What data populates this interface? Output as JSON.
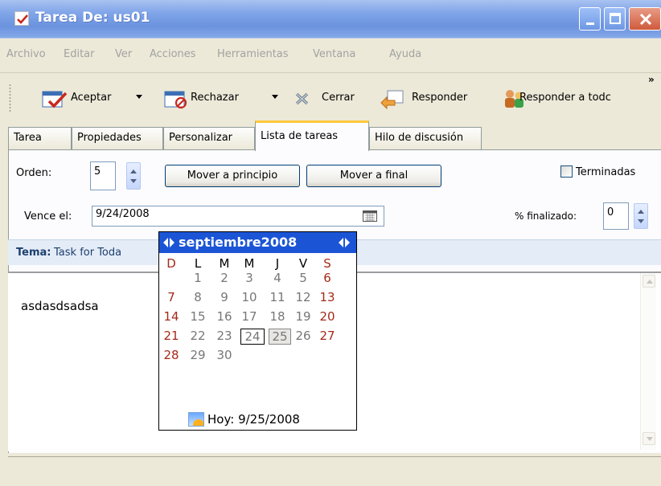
{
  "window": {
    "title": "Tarea De: us01",
    "accent": "#7fa4e8"
  },
  "menu": [
    "Archivo",
    "Editar",
    "Ver",
    "Acciones",
    "Herramientas",
    "Ventana",
    "Ayuda"
  ],
  "toolbar": {
    "accept": "Aceptar",
    "reject": "Rechazar",
    "close": "Cerrar",
    "reply": "Responder",
    "reply_all": "Responder a todc",
    "more": "»"
  },
  "tabs": [
    "Tarea",
    "Propiedades",
    "Personalizar",
    "Lista de tareas",
    "Hilo de discusión"
  ],
  "active_tab": "Lista de tareas",
  "form": {
    "order_label": "Orden:",
    "order_value": "5",
    "move_top": "Mover a principio",
    "move_bottom": "Mover a final",
    "finished_label": "Terminadas",
    "due_label": "Vence el:",
    "due_value": "9/24/2008",
    "percent_label": "% finalizado:",
    "percent_value": "0"
  },
  "subject": {
    "label": "Tema:",
    "value": "Task for Toda"
  },
  "body_text": "asdasdsadsa",
  "calendar": {
    "month_title": "septiembre2008",
    "weekdays": [
      "D",
      "L",
      "M",
      "M",
      "J",
      "V",
      "S"
    ],
    "weeks": [
      [
        "",
        "1",
        "2",
        "3",
        "4",
        "5",
        "6"
      ],
      [
        "7",
        "8",
        "9",
        "10",
        "11",
        "12",
        "13"
      ],
      [
        "14",
        "15",
        "16",
        "17",
        "18",
        "19",
        "20"
      ],
      [
        "21",
        "22",
        "23",
        "24",
        "25",
        "26",
        "27"
      ],
      [
        "28",
        "29",
        "30",
        "",
        "",
        "",
        ""
      ]
    ],
    "selected_day": "24",
    "today_day": "25",
    "today_label": "Hoy: 9/25/2008"
  }
}
